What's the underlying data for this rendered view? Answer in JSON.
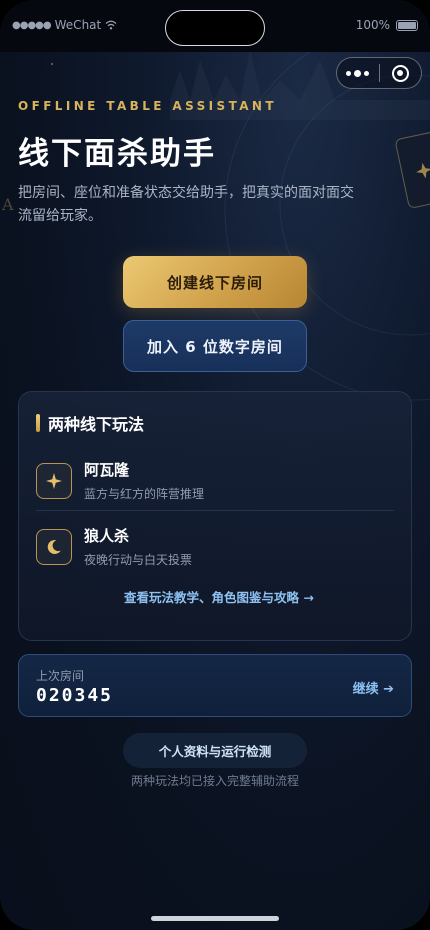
{
  "status_bar": {
    "carrier": "WeChat",
    "signal": "●●●●●",
    "battery": "100%"
  },
  "hero": {
    "eyebrow": "OFFLINE TABLE ASSISTANT",
    "title": "线下面杀助手",
    "subtitle": "把房间、座位和准备状态交给助手，把真实的面对面交流留给玩家。",
    "card_letter": "A"
  },
  "actions": {
    "create_room": "创建线下房间",
    "join_room": "加入 6 位数字房间"
  },
  "modes_card": {
    "title": "两种线下玩法",
    "modes": [
      {
        "name": "阿瓦隆",
        "desc": "蓝方与红方的阵营推理",
        "icon": "sparkle-icon"
      },
      {
        "name": "狼人杀",
        "desc": "夜晚行动与白天投票",
        "icon": "moon-icon"
      }
    ],
    "guide_link": "查看玩法教学、角色图鉴与攻略 →"
  },
  "last_room": {
    "label": "上次房间",
    "code": "020345",
    "continue": "继续 ➔"
  },
  "profile_button": "个人资料与运行检测",
  "footer_note": "两种玩法均已接入完整辅助流程",
  "colors": {
    "gold_accent": "#d9b35c",
    "link_blue": "#8ec1f2",
    "background": "#0a111f",
    "secondary_button": "#1d3a66"
  }
}
